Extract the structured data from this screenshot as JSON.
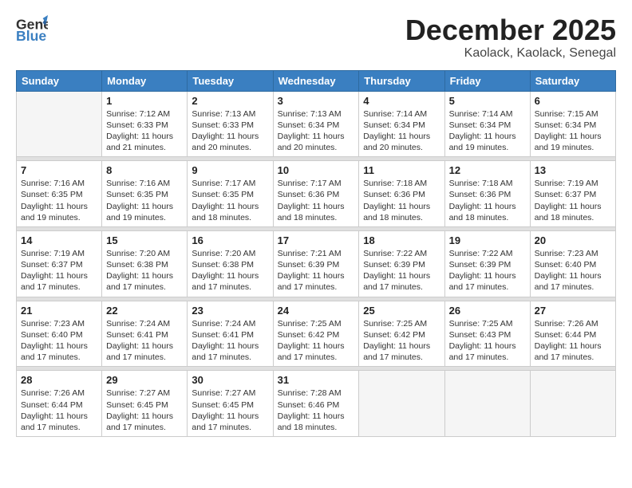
{
  "header": {
    "logo_general": "General",
    "logo_blue": "Blue",
    "month_title": "December 2025",
    "location": "Kaolack, Kaolack, Senegal"
  },
  "weekdays": [
    "Sunday",
    "Monday",
    "Tuesday",
    "Wednesday",
    "Thursday",
    "Friday",
    "Saturday"
  ],
  "weeks": [
    [
      {
        "day": "",
        "info": ""
      },
      {
        "day": "1",
        "info": "Sunrise: 7:12 AM\nSunset: 6:33 PM\nDaylight: 11 hours\nand 21 minutes."
      },
      {
        "day": "2",
        "info": "Sunrise: 7:13 AM\nSunset: 6:33 PM\nDaylight: 11 hours\nand 20 minutes."
      },
      {
        "day": "3",
        "info": "Sunrise: 7:13 AM\nSunset: 6:34 PM\nDaylight: 11 hours\nand 20 minutes."
      },
      {
        "day": "4",
        "info": "Sunrise: 7:14 AM\nSunset: 6:34 PM\nDaylight: 11 hours\nand 20 minutes."
      },
      {
        "day": "5",
        "info": "Sunrise: 7:14 AM\nSunset: 6:34 PM\nDaylight: 11 hours\nand 19 minutes."
      },
      {
        "day": "6",
        "info": "Sunrise: 7:15 AM\nSunset: 6:34 PM\nDaylight: 11 hours\nand 19 minutes."
      }
    ],
    [
      {
        "day": "7",
        "info": "Sunrise: 7:16 AM\nSunset: 6:35 PM\nDaylight: 11 hours\nand 19 minutes."
      },
      {
        "day": "8",
        "info": "Sunrise: 7:16 AM\nSunset: 6:35 PM\nDaylight: 11 hours\nand 19 minutes."
      },
      {
        "day": "9",
        "info": "Sunrise: 7:17 AM\nSunset: 6:35 PM\nDaylight: 11 hours\nand 18 minutes."
      },
      {
        "day": "10",
        "info": "Sunrise: 7:17 AM\nSunset: 6:36 PM\nDaylight: 11 hours\nand 18 minutes."
      },
      {
        "day": "11",
        "info": "Sunrise: 7:18 AM\nSunset: 6:36 PM\nDaylight: 11 hours\nand 18 minutes."
      },
      {
        "day": "12",
        "info": "Sunrise: 7:18 AM\nSunset: 6:36 PM\nDaylight: 11 hours\nand 18 minutes."
      },
      {
        "day": "13",
        "info": "Sunrise: 7:19 AM\nSunset: 6:37 PM\nDaylight: 11 hours\nand 18 minutes."
      }
    ],
    [
      {
        "day": "14",
        "info": "Sunrise: 7:19 AM\nSunset: 6:37 PM\nDaylight: 11 hours\nand 17 minutes."
      },
      {
        "day": "15",
        "info": "Sunrise: 7:20 AM\nSunset: 6:38 PM\nDaylight: 11 hours\nand 17 minutes."
      },
      {
        "day": "16",
        "info": "Sunrise: 7:20 AM\nSunset: 6:38 PM\nDaylight: 11 hours\nand 17 minutes."
      },
      {
        "day": "17",
        "info": "Sunrise: 7:21 AM\nSunset: 6:39 PM\nDaylight: 11 hours\nand 17 minutes."
      },
      {
        "day": "18",
        "info": "Sunrise: 7:22 AM\nSunset: 6:39 PM\nDaylight: 11 hours\nand 17 minutes."
      },
      {
        "day": "19",
        "info": "Sunrise: 7:22 AM\nSunset: 6:39 PM\nDaylight: 11 hours\nand 17 minutes."
      },
      {
        "day": "20",
        "info": "Sunrise: 7:23 AM\nSunset: 6:40 PM\nDaylight: 11 hours\nand 17 minutes."
      }
    ],
    [
      {
        "day": "21",
        "info": "Sunrise: 7:23 AM\nSunset: 6:40 PM\nDaylight: 11 hours\nand 17 minutes."
      },
      {
        "day": "22",
        "info": "Sunrise: 7:24 AM\nSunset: 6:41 PM\nDaylight: 11 hours\nand 17 minutes."
      },
      {
        "day": "23",
        "info": "Sunrise: 7:24 AM\nSunset: 6:41 PM\nDaylight: 11 hours\nand 17 minutes."
      },
      {
        "day": "24",
        "info": "Sunrise: 7:25 AM\nSunset: 6:42 PM\nDaylight: 11 hours\nand 17 minutes."
      },
      {
        "day": "25",
        "info": "Sunrise: 7:25 AM\nSunset: 6:42 PM\nDaylight: 11 hours\nand 17 minutes."
      },
      {
        "day": "26",
        "info": "Sunrise: 7:25 AM\nSunset: 6:43 PM\nDaylight: 11 hours\nand 17 minutes."
      },
      {
        "day": "27",
        "info": "Sunrise: 7:26 AM\nSunset: 6:44 PM\nDaylight: 11 hours\nand 17 minutes."
      }
    ],
    [
      {
        "day": "28",
        "info": "Sunrise: 7:26 AM\nSunset: 6:44 PM\nDaylight: 11 hours\nand 17 minutes."
      },
      {
        "day": "29",
        "info": "Sunrise: 7:27 AM\nSunset: 6:45 PM\nDaylight: 11 hours\nand 17 minutes."
      },
      {
        "day": "30",
        "info": "Sunrise: 7:27 AM\nSunset: 6:45 PM\nDaylight: 11 hours\nand 17 minutes."
      },
      {
        "day": "31",
        "info": "Sunrise: 7:28 AM\nSunset: 6:46 PM\nDaylight: 11 hours\nand 18 minutes."
      },
      {
        "day": "",
        "info": ""
      },
      {
        "day": "",
        "info": ""
      },
      {
        "day": "",
        "info": ""
      }
    ]
  ]
}
